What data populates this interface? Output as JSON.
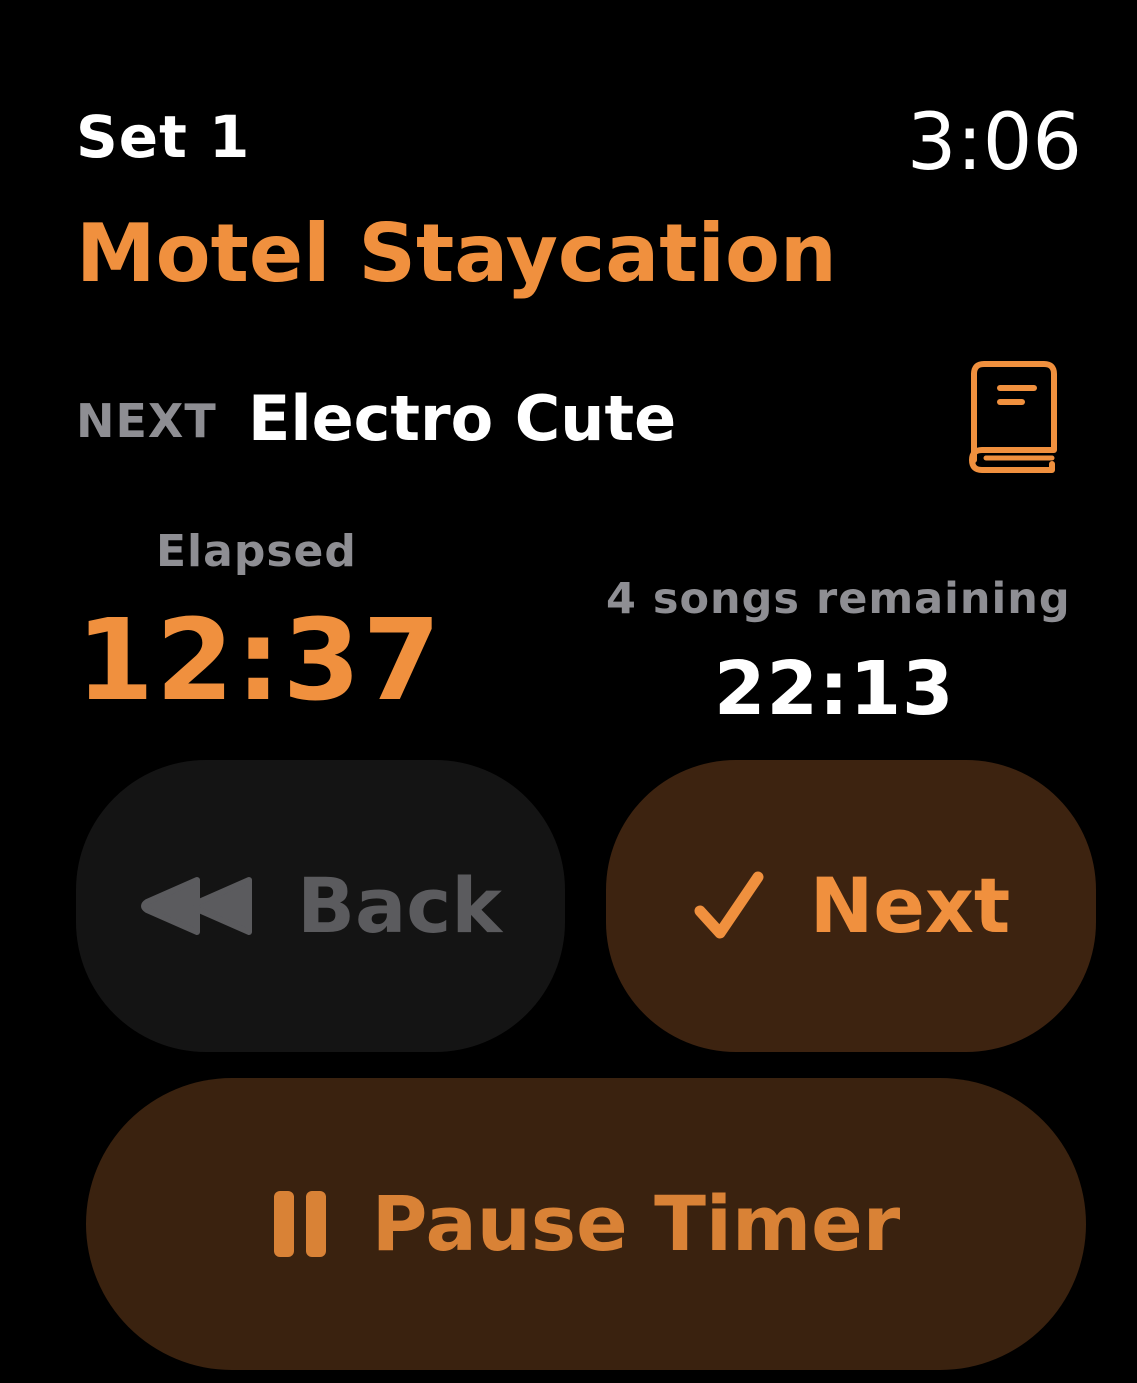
{
  "header": {
    "set_label": "Set 1",
    "clock": "3:06"
  },
  "current_song": {
    "title": "Motel Staycation"
  },
  "next_song": {
    "caption": "NEXT",
    "title": "Electro Cute",
    "icon": "book-icon"
  },
  "elapsed": {
    "caption": "Elapsed",
    "time": "12:37"
  },
  "remaining": {
    "caption": "4 songs remaining",
    "time": "22:13"
  },
  "controls": {
    "back_label": "Back",
    "back_icon": "rewind-icon",
    "next_label": "Next",
    "next_icon": "checkmark-icon",
    "pause_label": "Pause Timer",
    "pause_icon": "pause-icon"
  },
  "colors": {
    "accent": "#F0903E",
    "secondary_text": "#8e8e93",
    "background": "#000000",
    "back_button_bg": "#141414",
    "accent_button_bg": "#3d2310"
  }
}
